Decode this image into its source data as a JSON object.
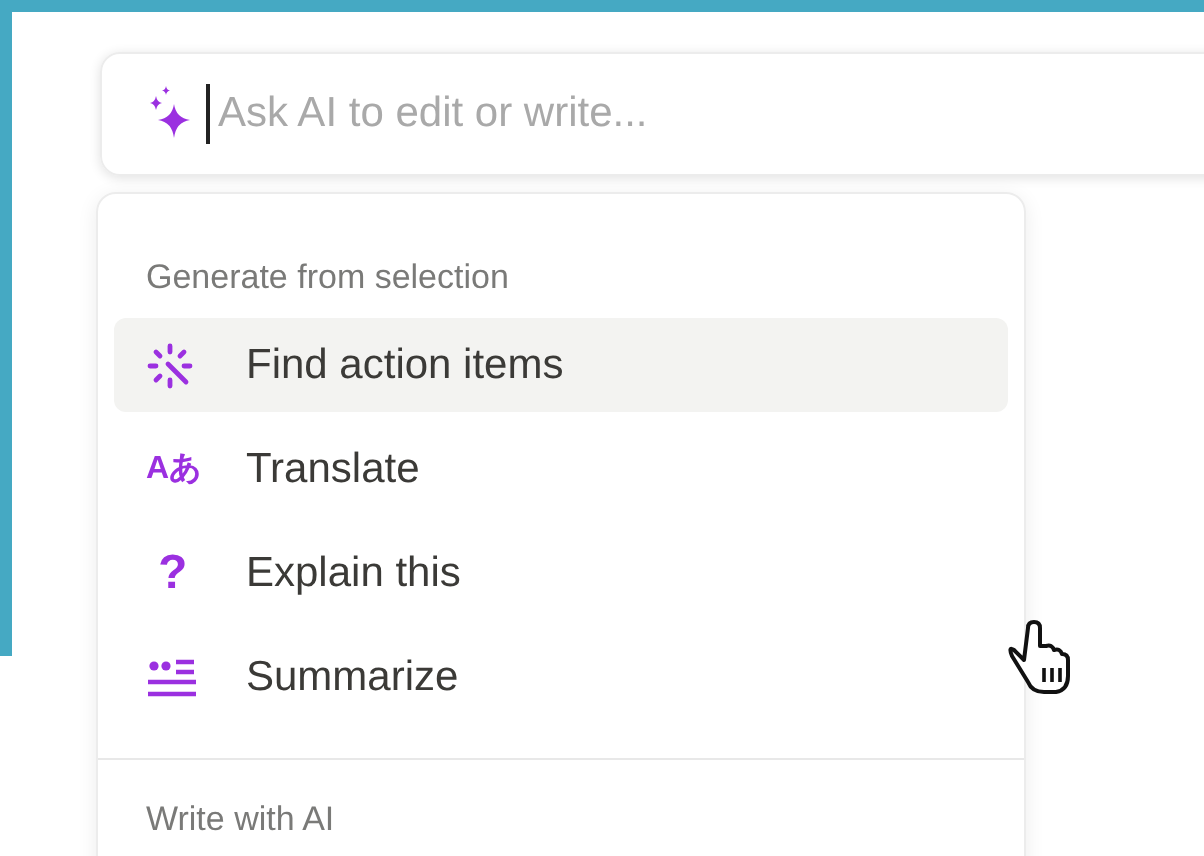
{
  "ai_prompt": {
    "placeholder": "Ask AI to edit or write..."
  },
  "menu": {
    "sections": [
      {
        "title": "Generate from selection",
        "items": [
          {
            "kind": "action-items",
            "label": "Find action items",
            "selected": true
          },
          {
            "kind": "translate",
            "icon_text": "Aあ",
            "label": "Translate",
            "selected": false
          },
          {
            "kind": "explain",
            "icon_text": "?",
            "label": "Explain this",
            "selected": false
          },
          {
            "kind": "summarize",
            "label": "Summarize",
            "selected": false
          }
        ]
      },
      {
        "title": "Write with AI"
      }
    ]
  }
}
